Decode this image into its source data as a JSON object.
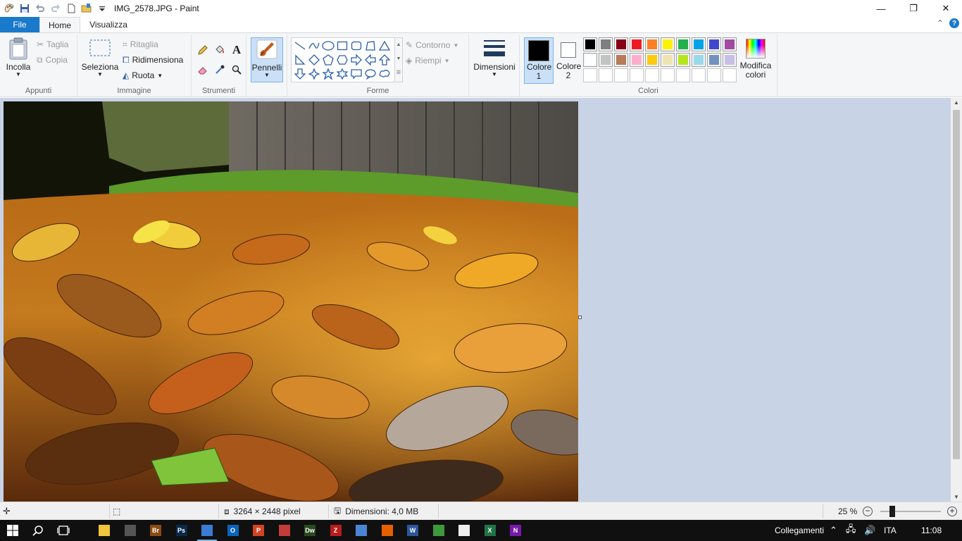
{
  "window": {
    "title": "IMG_2578.JPG - Paint",
    "minimize": "—",
    "restore": "❐",
    "close": "✕"
  },
  "tabs": {
    "file": "File",
    "home": "Home",
    "view": "Visualizza",
    "collapse": "⌃",
    "help": "?"
  },
  "ribbon": {
    "clipboard": {
      "label": "Appunti",
      "paste": "Incolla",
      "cut": "Taglia",
      "copy": "Copia"
    },
    "image": {
      "label": "Immagine",
      "select": "Seleziona",
      "crop": "Ritaglia",
      "resize": "Ridimensiona",
      "rotate": "Ruota"
    },
    "tools": {
      "label": "Strumenti"
    },
    "brushes": {
      "label": "Pennelli"
    },
    "shapes": {
      "label": "Forme",
      "outline": "Contorno",
      "fill": "Riempi"
    },
    "size": {
      "label": "Dimensioni"
    },
    "colors": {
      "label": "Colori",
      "color1": "Colore 1",
      "color2": "Colore 2",
      "edit": "Modifica colori",
      "color1_value": "#000000",
      "color2_value": "#ffffff",
      "row1": [
        "#000000",
        "#7f7f7f",
        "#880015",
        "#ed1c24",
        "#ff7f27",
        "#fff200",
        "#22b14c",
        "#00a2e8",
        "#3f48cc",
        "#a349a4"
      ],
      "row2": [
        "#ffffff",
        "#c3c3c3",
        "#b97a57",
        "#ffaec9",
        "#ffc90e",
        "#efe4b0",
        "#b5e61d",
        "#99d9ea",
        "#7092be",
        "#c8bfe7"
      ]
    }
  },
  "status": {
    "image_size": "3264 × 2448 pixel",
    "file_size": "Dimensioni: 4,0 MB",
    "zoom": "25 %",
    "zoom_percent": 25
  },
  "taskbar": {
    "apps": [
      {
        "name": "explorer-app",
        "label": "",
        "color": "#f2c53d"
      },
      {
        "name": "camera-app",
        "label": "",
        "color": "#555555"
      },
      {
        "name": "bridge-app",
        "label": "Br",
        "color": "#8a4b12"
      },
      {
        "name": "photoshop-app",
        "label": "Ps",
        "color": "#0b2a4a"
      },
      {
        "name": "paint-app",
        "label": "",
        "color": "#3a7bd5"
      },
      {
        "name": "outlook-app",
        "label": "O",
        "color": "#0a64b8"
      },
      {
        "name": "powerpoint-app",
        "label": "P",
        "color": "#d04423"
      },
      {
        "name": "daisydisk-app",
        "label": "",
        "color": "#c23c3c"
      },
      {
        "name": "dreamweaver-app",
        "label": "Dw",
        "color": "#2c4a1e"
      },
      {
        "name": "filezilla-app",
        "label": "Z",
        "color": "#b81c1c"
      },
      {
        "name": "notes-app",
        "label": "",
        "color": "#4a86d4"
      },
      {
        "name": "firefox-app",
        "label": "",
        "color": "#e66000"
      },
      {
        "name": "word-app",
        "label": "W",
        "color": "#2b579a"
      },
      {
        "name": "green-app",
        "label": "",
        "color": "#3c9a3c"
      },
      {
        "name": "file-app",
        "label": "",
        "color": "#eeeeee"
      },
      {
        "name": "excel-app",
        "label": "X",
        "color": "#217346"
      },
      {
        "name": "onenote-app",
        "label": "N",
        "color": "#7719aa"
      }
    ],
    "tray_label": "Collegamenti",
    "language": "ITA",
    "time": "11:08"
  }
}
